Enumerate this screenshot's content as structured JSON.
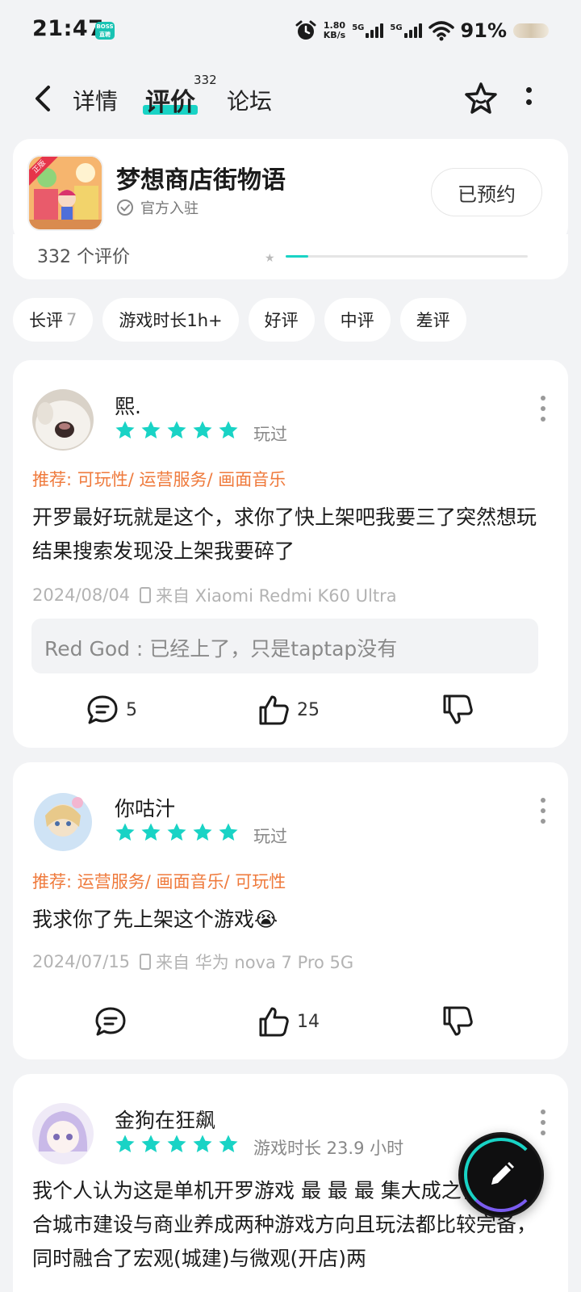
{
  "status_bar": {
    "time": "21:47",
    "boss_badge": "BOSS\n直聘",
    "speed_value": "1.80",
    "speed_unit": "KB/s",
    "net1": "5G",
    "net2": "5G",
    "battery": "91%"
  },
  "nav": {
    "tabs": [
      {
        "label": "详情"
      },
      {
        "label": "评价",
        "count": "332"
      },
      {
        "label": "论坛"
      }
    ]
  },
  "game": {
    "title": "梦想商店街物语",
    "official_label": "官方入驻",
    "reserve_label": "已预约",
    "icon_ribbon": "正版"
  },
  "rating_strip": {
    "count_text": "332 个评价"
  },
  "filters": [
    {
      "label": "长评",
      "count": "7"
    },
    {
      "label": "游戏时长1h+",
      "count": ""
    },
    {
      "label": "好评",
      "count": ""
    },
    {
      "label": "中评",
      "count": ""
    },
    {
      "label": "差评",
      "count": ""
    }
  ],
  "reviews": [
    {
      "username": "熙.",
      "rating": 5,
      "played": "玩过",
      "recommend": "推荐: 可玩性/ 运营服务/ 画面音乐",
      "text": "开罗最好玩就是这个，求你了快上架吧我要三了突然想玩结果搜索发现没上架我要碎了",
      "date": "2024/08/04",
      "device": "来自 Xiaomi Redmi K60 Ultra",
      "reply": "Red God : 已经上了，只是taptap没有",
      "comments": "5",
      "likes": "25"
    },
    {
      "username": "你咕汁",
      "rating": 5,
      "played": "玩过",
      "recommend": "推荐: 运营服务/ 画面音乐/ 可玩性",
      "text": "我求你了先上架这个游戏😭",
      "date": "2024/07/15",
      "device": "来自 华为 nova 7 Pro 5G",
      "comments": "",
      "likes": "14"
    },
    {
      "username": "金狗在狂飙",
      "rating": 5,
      "played": "游戏时长 23.9 小时",
      "text": "我个人认为这是单机开罗游戏 最 最 最 集大成之作，结合城市建设与商业养成两种游戏方向且玩法都比较完备，同时融合了宏观(城建)与微观(开店)两"
    }
  ],
  "colors": {
    "accent": "#19d3c5",
    "recommend": "#ef7a3c",
    "background": "#f2f3f5"
  }
}
